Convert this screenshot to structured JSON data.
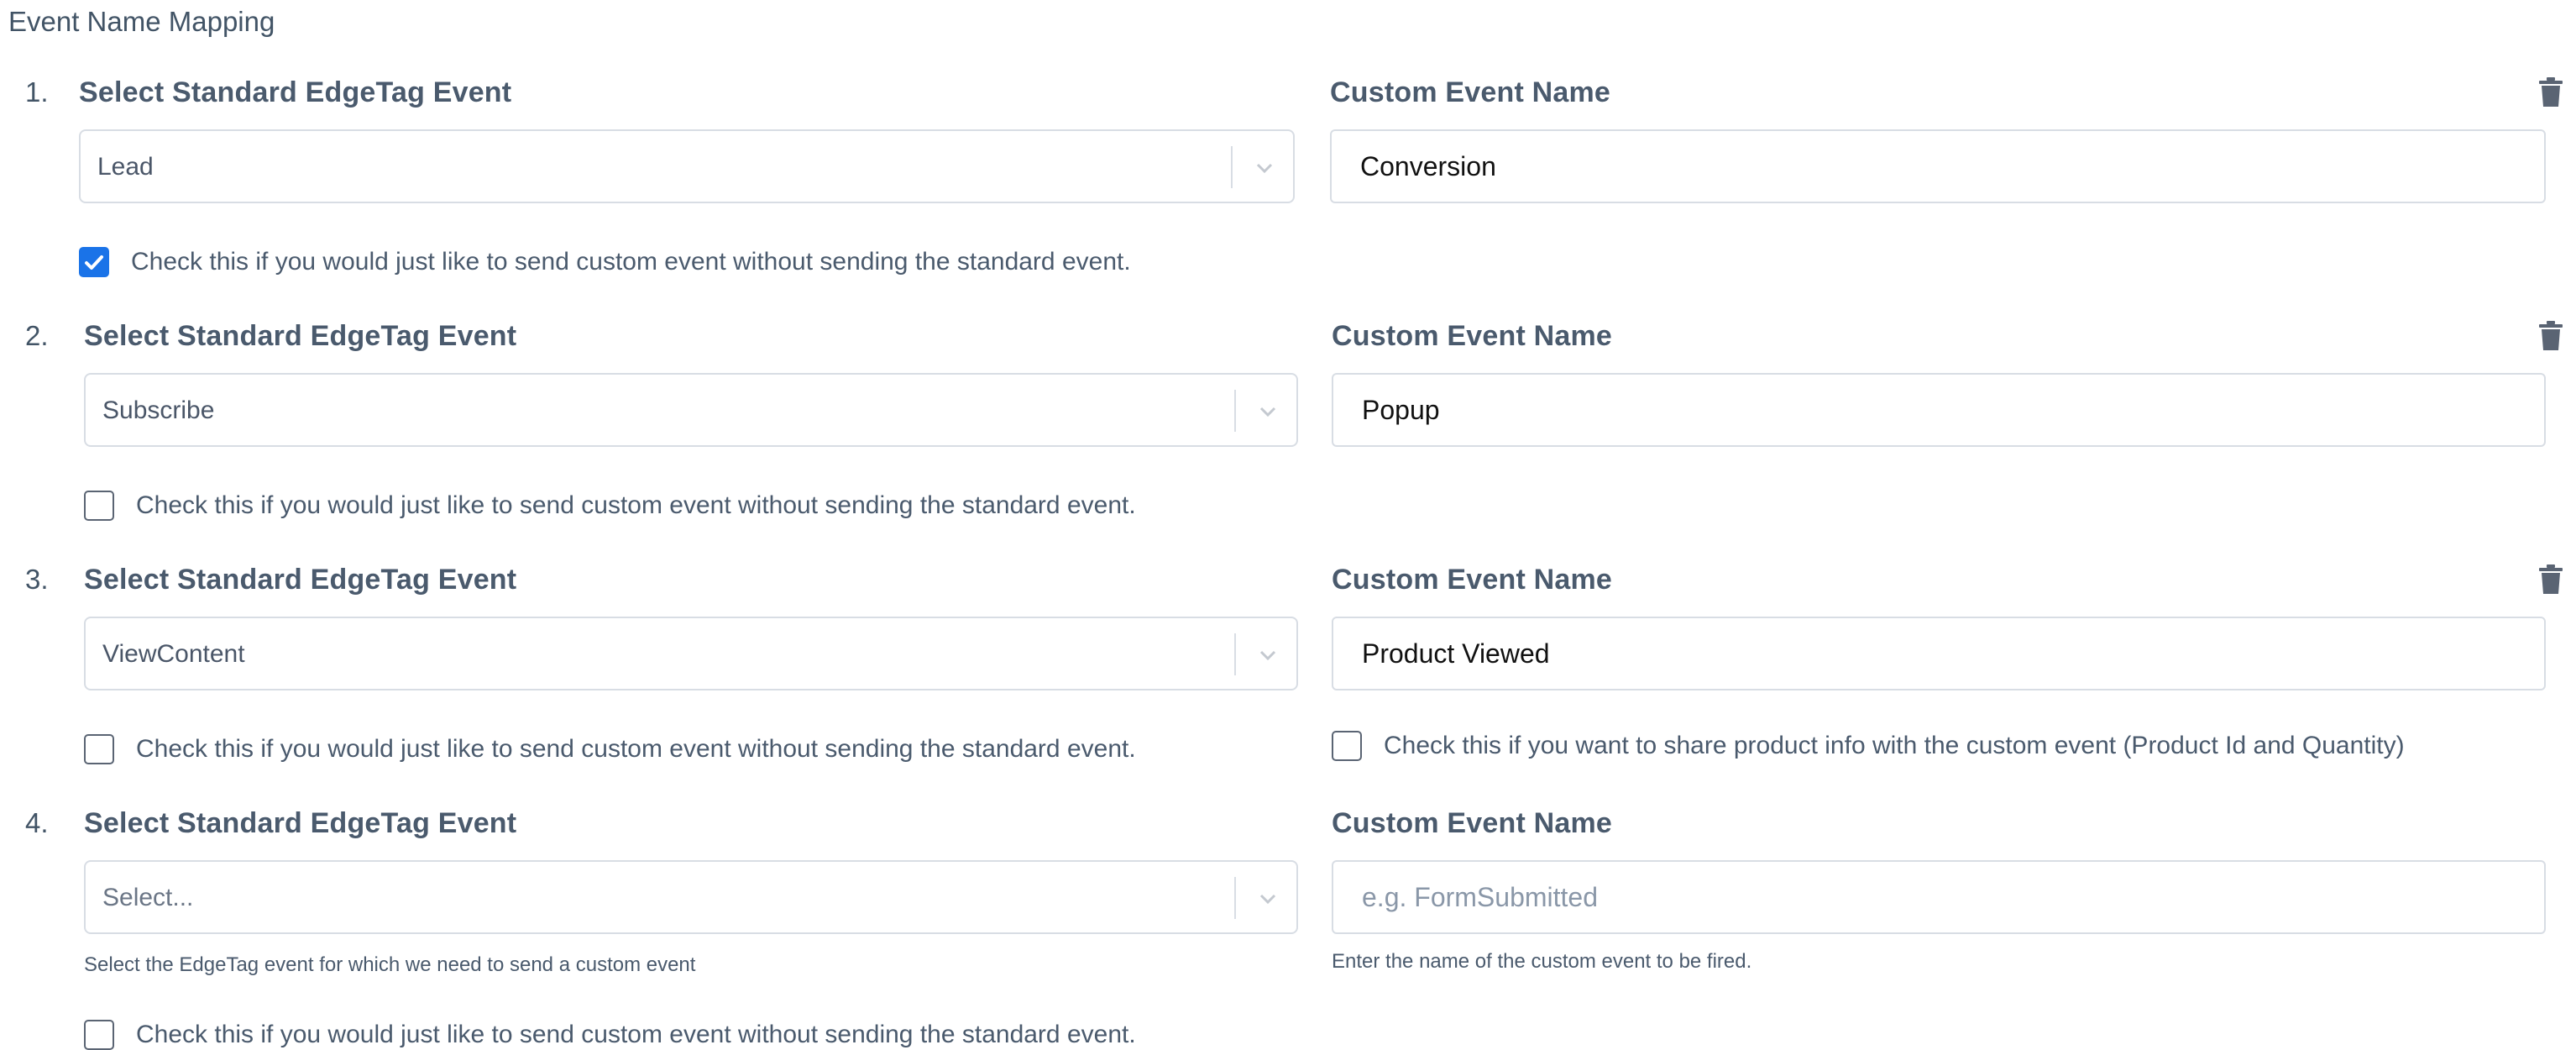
{
  "section": {
    "title": "Event Name Mapping"
  },
  "mappings": [
    {
      "number": "1.",
      "select_label": "Select Standard EdgeTag Event",
      "select_value": "Lead",
      "custom_label": "Custom Event Name",
      "custom_value": "Conversion",
      "checkbox_label": "Check this if you would just like to send custom event without sending the standard event.",
      "checked": true
    },
    {
      "number": "2.",
      "select_label": "Select Standard EdgeTag Event",
      "select_value": "Subscribe",
      "custom_label": "Custom Event Name",
      "custom_value": "Popup",
      "checkbox_label": "Check this if you would just like to send custom event without sending the standard event.",
      "checked": false
    },
    {
      "number": "3.",
      "select_label": "Select Standard EdgeTag Event",
      "select_value": "ViewContent",
      "custom_label": "Custom Event Name",
      "custom_value": "Product Viewed",
      "checkbox_label": "Check this if you would just like to send custom event without sending the standard event.",
      "checked": false,
      "product_checkbox_label": "Check this if you want to share product info with the custom event (Product Id and Quantity)",
      "product_checked": false
    },
    {
      "number": "4.",
      "select_label": "Select Standard EdgeTag Event",
      "select_placeholder": "Select...",
      "select_help": "Select the EdgeTag event for which we need to send a custom event",
      "custom_label": "Custom Event Name",
      "custom_placeholder": "e.g. FormSubmitted",
      "custom_help": "Enter the name of the custom event to be fired.",
      "checkbox_label": "Check this if you would just like to send custom event without sending the standard event.",
      "checked": false
    }
  ],
  "icons": {
    "delete": "trash-icon",
    "dropdown": "chevron-down-icon",
    "check": "checkmark-icon"
  },
  "colors": {
    "accent": "#1a73e8",
    "label": "#4a5a6d",
    "border": "#d8dde4",
    "icon": "#5a6473"
  }
}
